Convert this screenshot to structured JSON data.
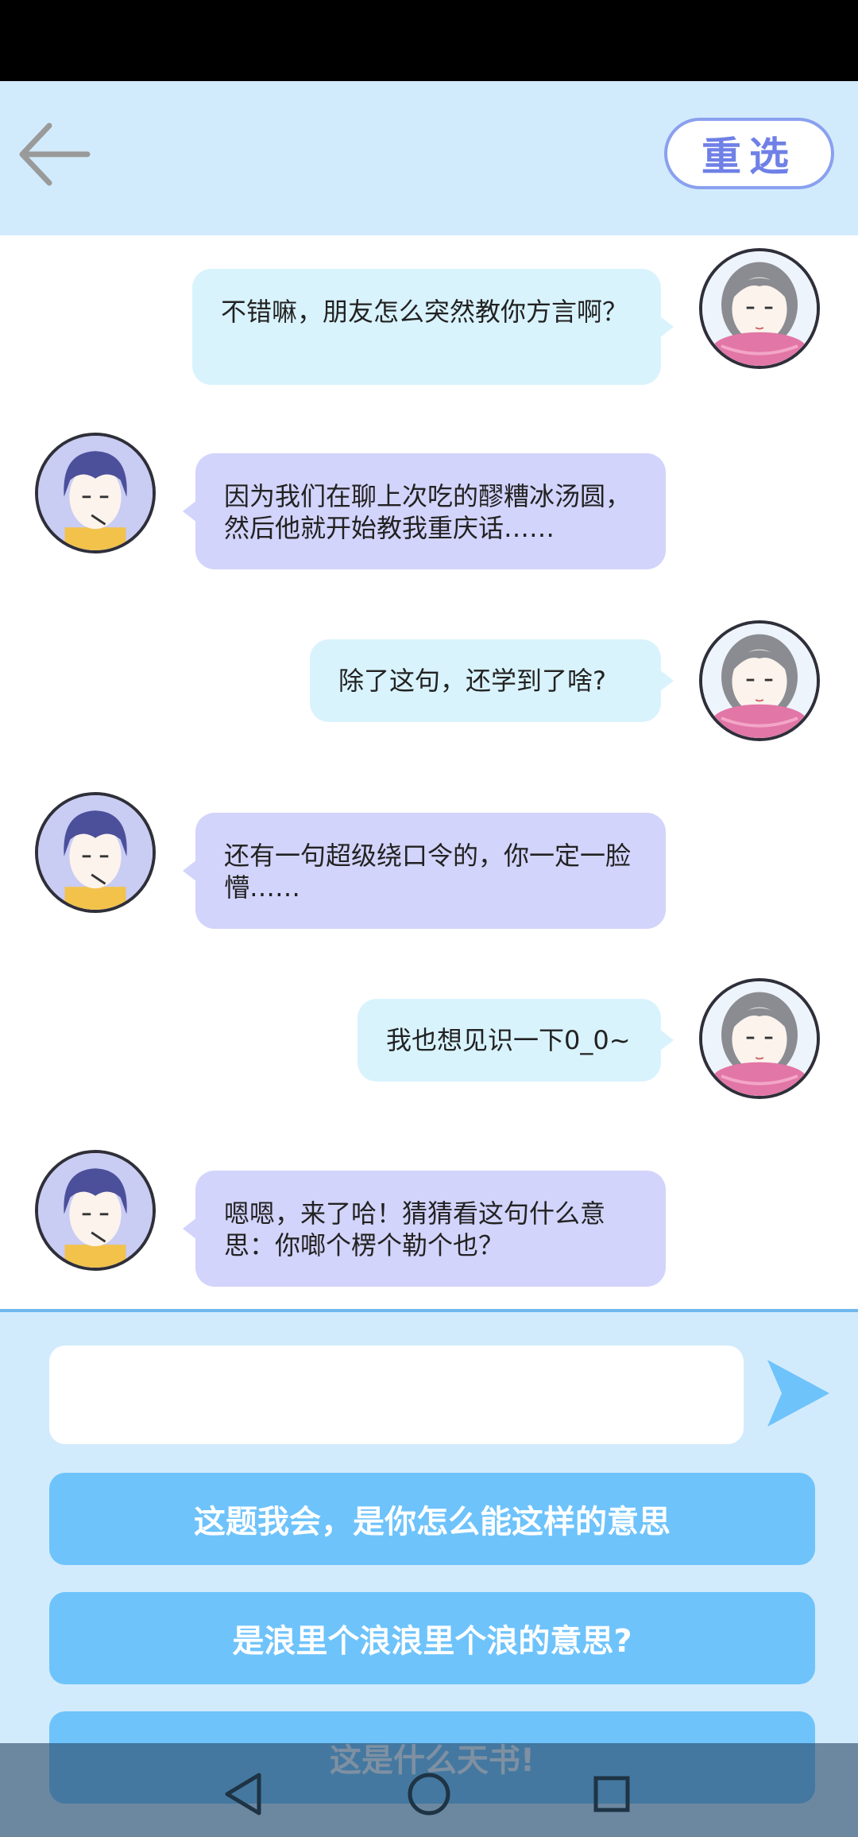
{
  "header": {
    "back_icon": "arrow-left-icon",
    "reselect_label": "重选"
  },
  "messages": [
    {
      "side": "right",
      "avatar": "girl-avatar",
      "text": "不错嘛，朋友怎么突然教你方言啊？"
    },
    {
      "side": "left",
      "avatar": "boy-avatar",
      "text": "因为我们在聊上次吃的醪糟冰汤圆，然后他就开始教我重庆话……"
    },
    {
      "side": "right",
      "avatar": "girl-avatar",
      "text": "除了这句，还学到了啥?"
    },
    {
      "side": "left",
      "avatar": "boy-avatar",
      "text": "还有一句超级绕口令的，你一定一脸懵……"
    },
    {
      "side": "right",
      "avatar": "girl-avatar",
      "text": "我也想见识一下0_0~"
    },
    {
      "side": "left",
      "avatar": "boy-avatar",
      "text": "嗯嗯，来了哈！猜猜看这句什么意思：你啷个楞个勒个也？"
    }
  ],
  "input": {
    "value": "",
    "placeholder": "",
    "send_icon": "send-arrow-icon"
  },
  "options": [
    "这题我会，是你怎么能这样的意思",
    "是浪里个浪浪里个浪的意思?",
    "这是什么天书!"
  ],
  "nav": {
    "back_icon": "triangle-back-icon",
    "home_icon": "circle-home-icon",
    "recents_icon": "square-recents-icon"
  },
  "colors": {
    "header_bg": "#d2ebfc",
    "right_bubble": "#d9f3fd",
    "left_bubble": "#d3d4fb",
    "option_button": "#6ec3fb",
    "send_arrow": "#6ec3fb"
  }
}
